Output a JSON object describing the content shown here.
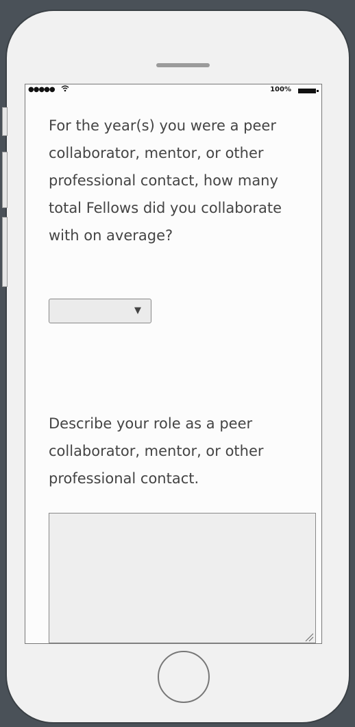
{
  "status_bar": {
    "signal": "●●●●●",
    "wifi_icon": "wifi-icon",
    "battery_text": "100%",
    "battery_icon": "battery-icon"
  },
  "form": {
    "question_collab_count": "For the year(s) you were a peer collaborator, mentor, or other professional contact, how many total Fellows did you collaborate with on average?",
    "collab_count_select": {
      "selected_value": "",
      "arrow": "▼"
    },
    "question_role_description": "Describe your role as a peer collaborator, mentor, or other professional contact.",
    "role_description_textarea": {
      "value": ""
    }
  },
  "colors": {
    "background": "#4a5158",
    "phone_body": "#f1f1f1",
    "screen": "#fcfcfc",
    "text": "#444444"
  }
}
